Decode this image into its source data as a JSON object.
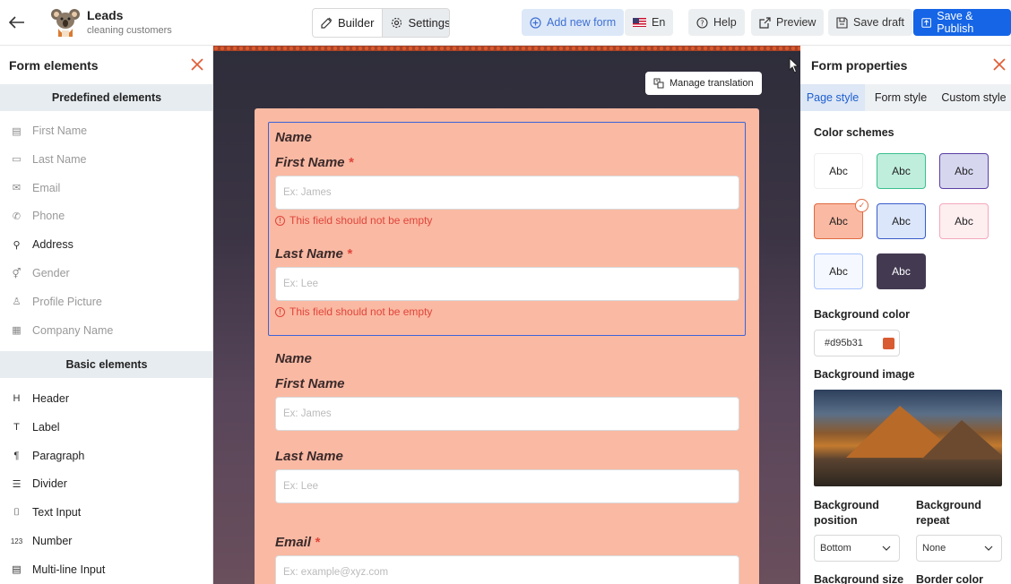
{
  "header": {
    "title": "Leads",
    "subtitle": "cleaning customers",
    "builder_label": "Builder",
    "settings_label": "Settings",
    "add_new_label": "Add new form",
    "lang_label": "En",
    "help_label": "Help",
    "preview_label": "Preview",
    "save_draft_label": "Save draft",
    "publish_label": "Save & Publish"
  },
  "left_panel": {
    "title": "Form elements",
    "predefined_title": "Predefined elements",
    "predefined": [
      {
        "label": "First Name",
        "icon": "id-badge-icon",
        "glyph": "▤",
        "muted": true
      },
      {
        "label": "Last Name",
        "icon": "id-card-icon",
        "glyph": "▭",
        "muted": true
      },
      {
        "label": "Email",
        "icon": "mail-icon",
        "glyph": "✉",
        "muted": true
      },
      {
        "label": "Phone",
        "icon": "phone-icon",
        "glyph": "✆",
        "muted": true
      },
      {
        "label": "Address",
        "icon": "person-icon",
        "glyph": "⚲",
        "muted": false
      },
      {
        "label": "Gender",
        "icon": "gender-icon",
        "glyph": "⚥",
        "muted": true
      },
      {
        "label": "Profile Picture",
        "icon": "user-icon",
        "glyph": "♙",
        "muted": true
      },
      {
        "label": "Company Name",
        "icon": "building-icon",
        "glyph": "▦",
        "muted": true
      }
    ],
    "basic_title": "Basic elements",
    "basic": [
      {
        "label": "Header",
        "icon": "header-icon",
        "glyph": "H"
      },
      {
        "label": "Label",
        "icon": "text-icon",
        "glyph": "T"
      },
      {
        "label": "Paragraph",
        "icon": "paragraph-icon",
        "glyph": "¶"
      },
      {
        "label": "Divider",
        "icon": "divider-icon",
        "glyph": "☰"
      },
      {
        "label": "Text Input",
        "icon": "text-input-icon",
        "glyph": "⌷"
      },
      {
        "label": "Number",
        "icon": "number-icon",
        "glyph": "123"
      },
      {
        "label": "Multi-line Input",
        "icon": "multiline-icon",
        "glyph": "▤"
      }
    ]
  },
  "canvas": {
    "manage_translation": "Manage translation",
    "group1": {
      "heading": "Name",
      "first_label": "First Name",
      "first_placeholder": "Ex: James",
      "first_error": "This field should not be empty",
      "last_label": "Last Name",
      "last_placeholder": "Ex: Lee",
      "last_error": "This field should not be empty",
      "required_mark": "*"
    },
    "group2": {
      "heading": "Name",
      "first_label": "First Name",
      "first_placeholder": "Ex: James",
      "last_label": "Last Name",
      "last_placeholder": "Ex: Lee"
    },
    "email": {
      "label": "Email",
      "required_mark": "*",
      "placeholder": "Ex: example@xyz.com"
    }
  },
  "right_panel": {
    "title": "Form properties",
    "tabs": [
      "Page style",
      "Form style",
      "Custom style"
    ],
    "active_tab": "Page style",
    "color_schemes_label": "Color schemes",
    "schemes": [
      {
        "text": "Abc",
        "bg": "#ffffff",
        "border": "#eeeeee",
        "fg": "#222222"
      },
      {
        "text": "Abc",
        "bg": "#bfeedd",
        "border": "#3bbf8e",
        "fg": "#222222"
      },
      {
        "text": "Abc",
        "bg": "#d6d6ef",
        "border": "#5b3fa3",
        "fg": "#222222"
      },
      {
        "text": "Abc",
        "bg": "#fab9a3",
        "border": "#e06a40",
        "fg": "#222222",
        "selected": true
      },
      {
        "text": "Abc",
        "bg": "#dbe6fb",
        "border": "#3a5bc9",
        "fg": "#222222"
      },
      {
        "text": "Abc",
        "bg": "#fdeef0",
        "border": "#f4a9bc",
        "fg": "#222222"
      },
      {
        "text": "Abc",
        "bg": "#f5f8ff",
        "border": "#a8c4ff",
        "fg": "#222222"
      },
      {
        "text": "Abc",
        "bg": "#433a52",
        "border": "#433a52",
        "fg": "#ffffff"
      }
    ],
    "background_color_label": "Background color",
    "background_color_value": "#d95b31",
    "background_image_label": "Background image",
    "bg_position_label": "Background position",
    "bg_position_value": "Bottom",
    "bg_repeat_label": "Background repeat",
    "bg_repeat_value": "None",
    "bg_size_label": "Background size",
    "border_color_label": "Border color"
  }
}
